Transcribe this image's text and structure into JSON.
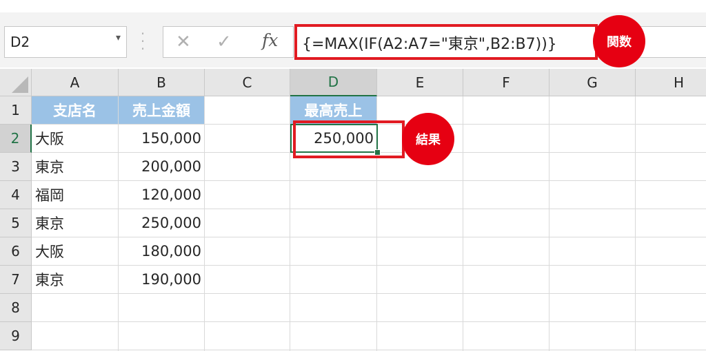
{
  "formula_bar": {
    "name_box": "D2",
    "formula": "{=MAX(IF(A2:A7=\"東京\",B2:B7))}",
    "icons": [
      "cancel-icon",
      "enter-icon",
      "fx-icon"
    ],
    "fx_label": "fx",
    "cancel_glyph": "✕",
    "enter_glyph": "✓",
    "dropdown_glyph": "▾"
  },
  "annotations": {
    "function_badge": "関数",
    "result_badge": "結果",
    "accent_color": "#e60012"
  },
  "sheet": {
    "columns": [
      "A",
      "B",
      "C",
      "D",
      "E",
      "F",
      "G",
      "H"
    ],
    "rows": [
      "1",
      "2",
      "3",
      "4",
      "5",
      "6",
      "7",
      "8",
      "9"
    ],
    "selected_cell": "D2",
    "header_fill": "#9bc2e6",
    "table": {
      "headers": [
        "支店名",
        "売上金額"
      ],
      "data": [
        [
          "大阪",
          "150,000"
        ],
        [
          "東京",
          "200,000"
        ],
        [
          "福岡",
          "120,000"
        ],
        [
          "東京",
          "250,000"
        ],
        [
          "大阪",
          "180,000"
        ],
        [
          "東京",
          "190,000"
        ]
      ]
    },
    "result": {
      "header": "最高売上",
      "value": "250,000"
    }
  }
}
